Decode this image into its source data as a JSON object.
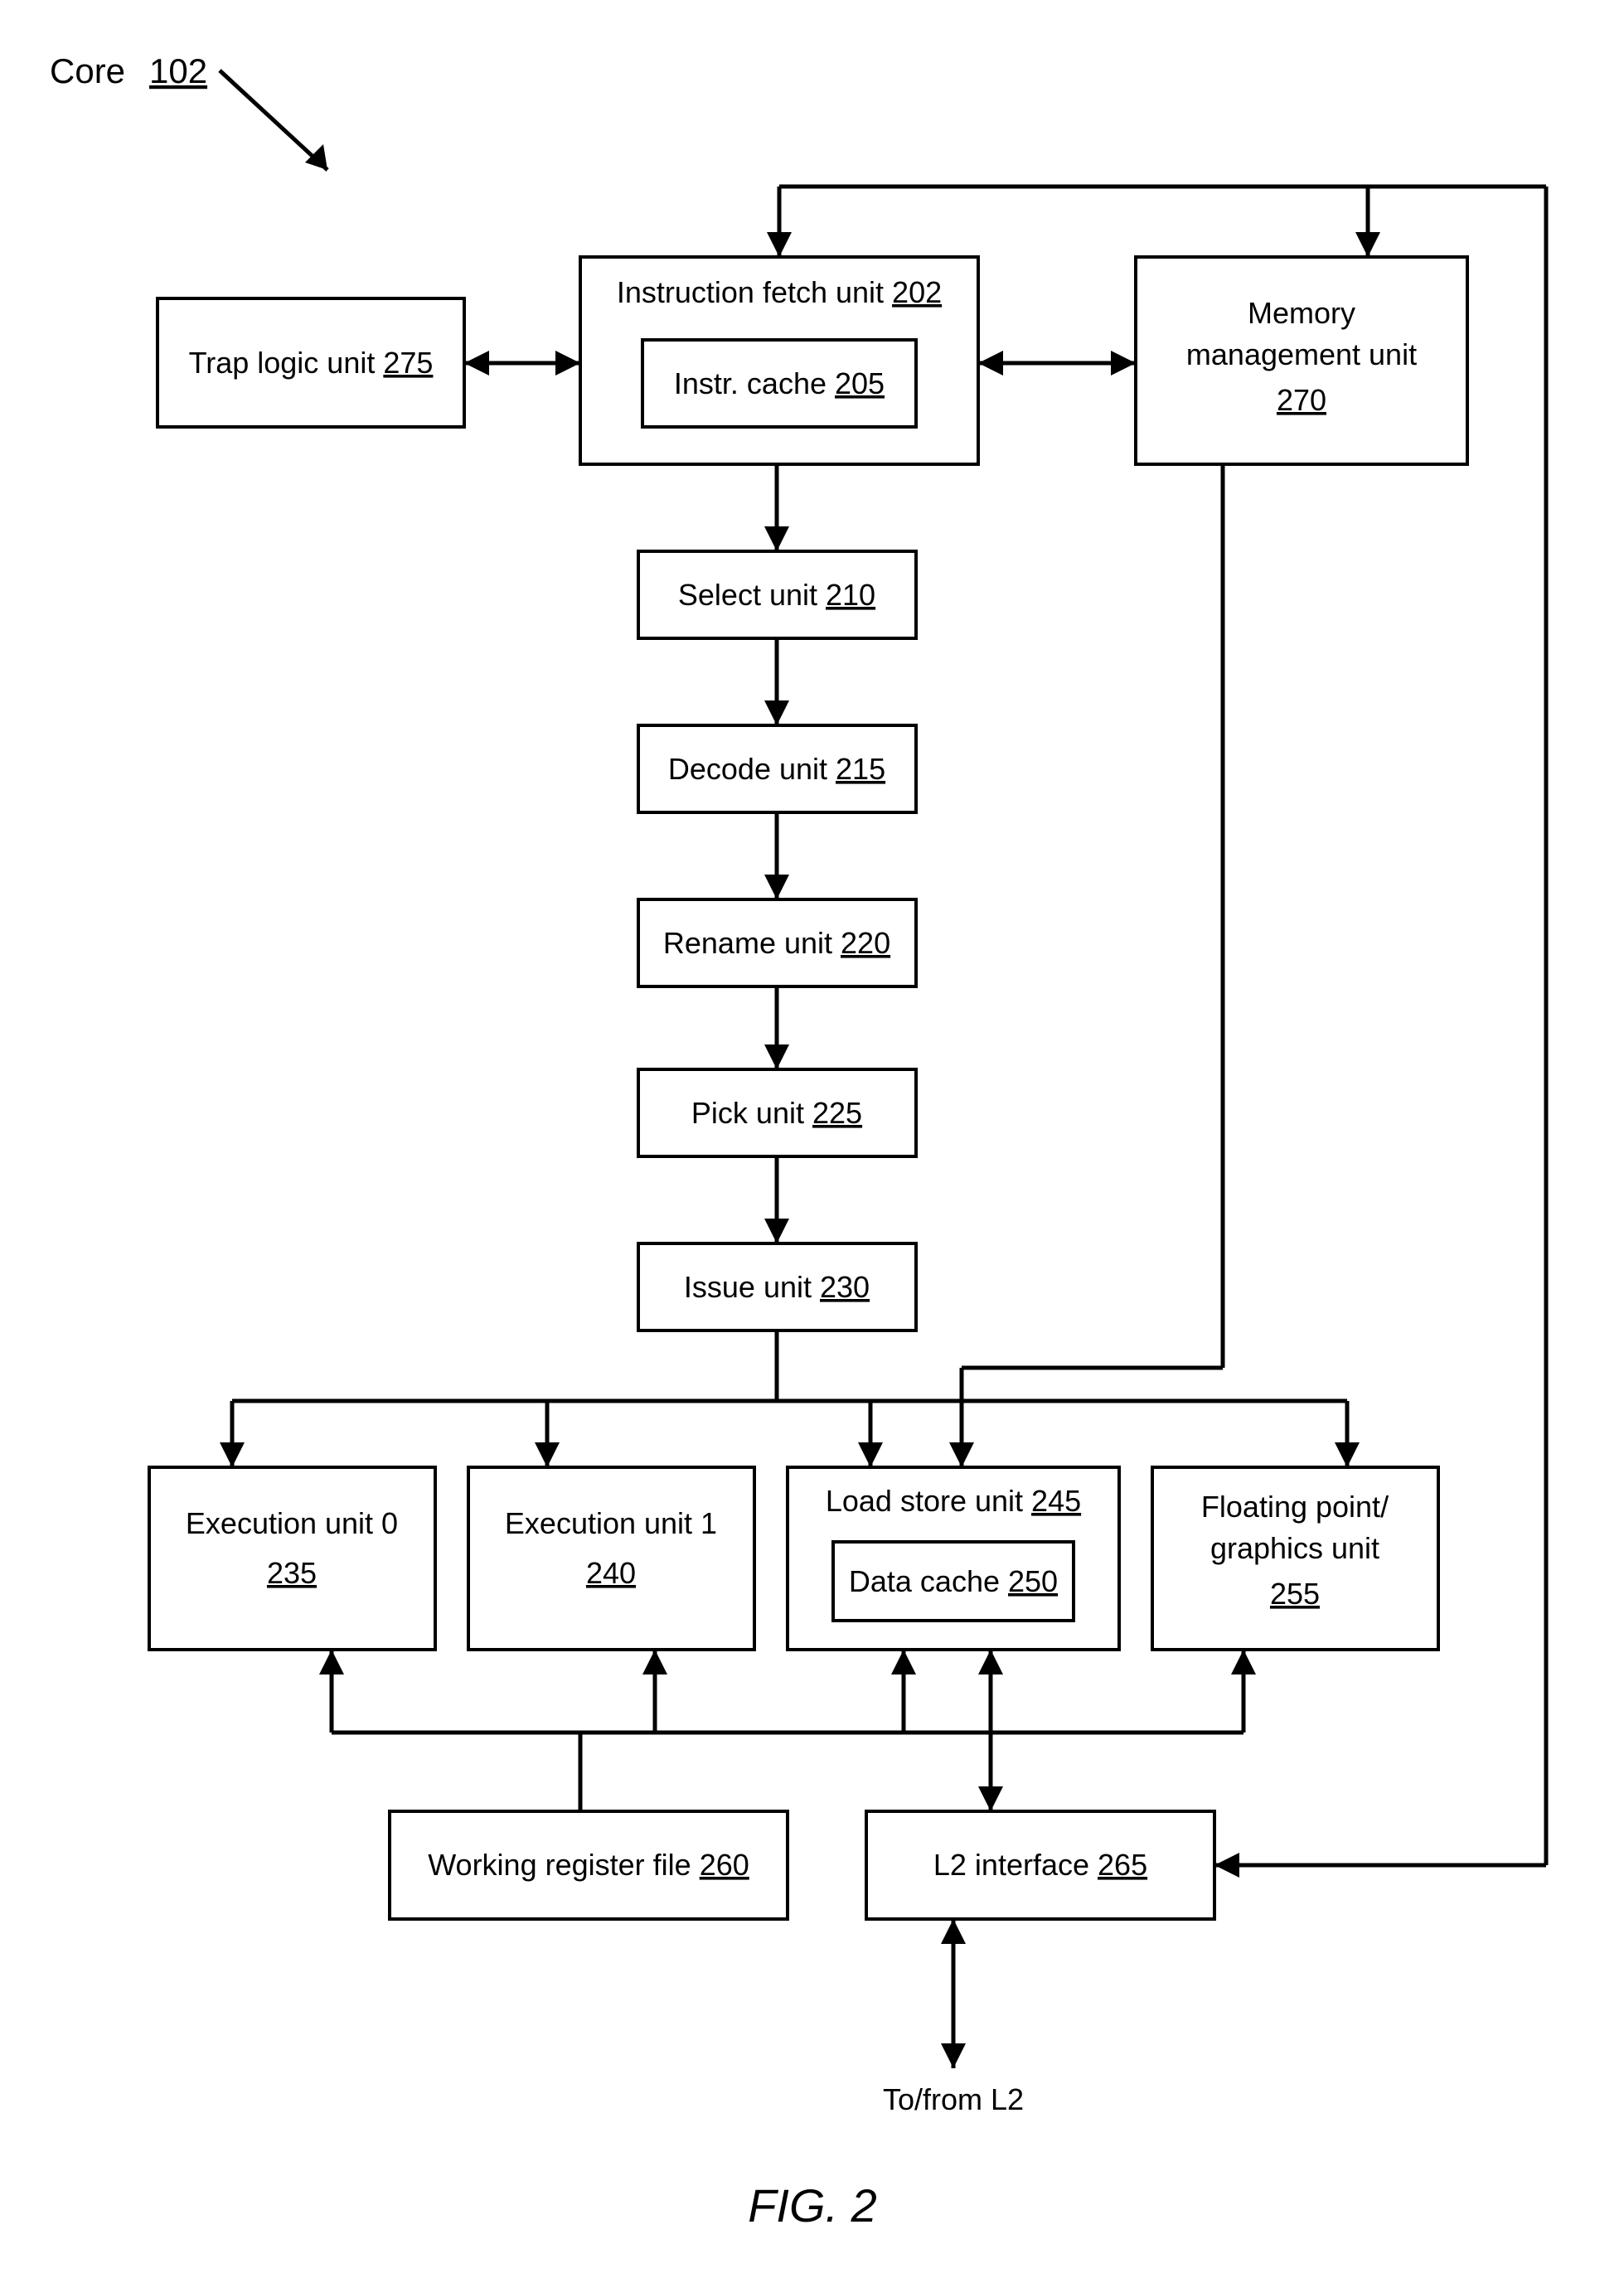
{
  "title": {
    "label": "Core",
    "ref": "102"
  },
  "boxes": {
    "ifu": {
      "label": "Instruction fetch unit",
      "ref": "202"
    },
    "icache": {
      "label": "Instr. cache",
      "ref": "205"
    },
    "tlu": {
      "label": "Trap logic unit",
      "ref": "275"
    },
    "mmu_l1": {
      "label": "Memory"
    },
    "mmu_l2": {
      "label": "management unit"
    },
    "mmu_ref": {
      "ref": "270"
    },
    "select": {
      "label": "Select unit",
      "ref": "210"
    },
    "decode": {
      "label": "Decode unit",
      "ref": "215"
    },
    "rename": {
      "label": "Rename unit",
      "ref": "220"
    },
    "pick": {
      "label": "Pick unit",
      "ref": "225"
    },
    "issue": {
      "label": "Issue unit",
      "ref": "230"
    },
    "exu0": {
      "label": "Execution unit 0",
      "ref": "235"
    },
    "exu1": {
      "label": "Execution unit 1",
      "ref": "240"
    },
    "lsu": {
      "label": "Load store unit",
      "ref": "245"
    },
    "dcache": {
      "label": "Data cache",
      "ref": "250"
    },
    "fgu_l1": {
      "label": "Floating point/"
    },
    "fgu_l2": {
      "label": "graphics unit"
    },
    "fgu_ref": {
      "ref": "255"
    },
    "wrf": {
      "label": "Working register file",
      "ref": "260"
    },
    "l2i": {
      "label": "L2 interface",
      "ref": "265"
    }
  },
  "labels": {
    "tofrom": "To/from L2"
  },
  "figure": "FIG. 2"
}
